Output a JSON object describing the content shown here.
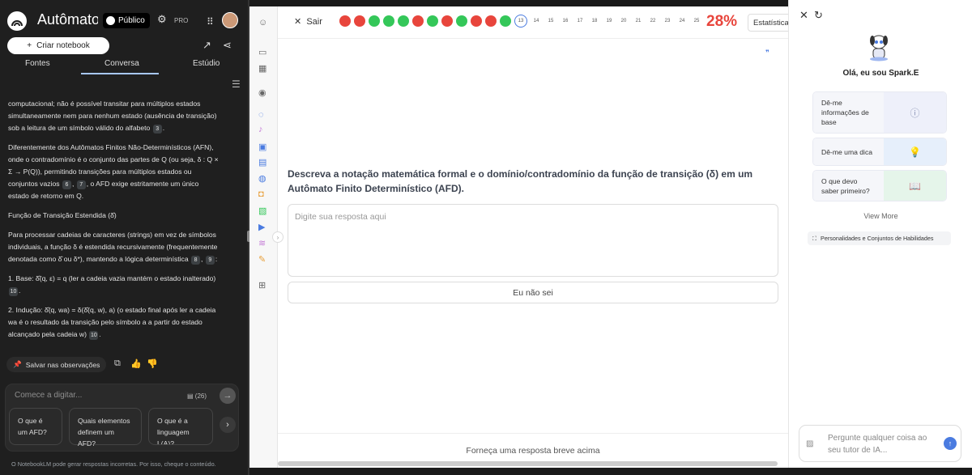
{
  "left": {
    "app_title": "Autômatos F",
    "public_badge": "Público",
    "pro_label": "PRO",
    "create_notebook": "Criar notebook",
    "tabs": [
      "Fontes",
      "Conversa",
      "Estúdio"
    ],
    "paragraphs": [
      "computacional; não é possível transitar para múltiplos estados simultaneamente nem para nenhum estado (ausência de transição) sob a leitura de um símbolo válido do alfabeto",
      "Diferentemente dos Autômatos Finitos Não-Determinísticos (AFN), onde o contradomínio é o conjunto das partes de Q (ou seja, δ : Q × Σ → P(Q)), permitindo transições para múltiplos estados ou conjuntos vazios",
      "Função de Transição Estendida (δ̂)",
      "Para processar cadeias de caracteres (strings) em vez de símbolos individuais, a função δ é estendida recursivamente (frequentemente denotada como δ̂ ou δ*), mantendo a lógica determinística",
      "1. Base: δ̂(q, ε) = q (ler a cadeia vazia mantém o estado inalterado)",
      "2. Indução: δ̂(q, wa) = δ(δ̂(q, w), a) (o estado final após ler a cadeia wa é o resultado da transição pelo símbolo a a partir do estado alcançado pela cadeia w)"
    ],
    "p2_tail": ", o AFD exige estritamente um único estado de retorno em Q.",
    "citations": {
      "c3": "3",
      "c6": "6",
      "c7": "7",
      "c8": "8",
      "c9": "9",
      "c10a": "10",
      "c10b": "10"
    },
    "save_label": "Salvar nas observações",
    "input_placeholder": "Comece a digitar...",
    "source_count": "(26)",
    "suggestions": [
      "O que é um AFD?",
      "Quais elementos definem um AFD?",
      "O que é a linguagem L(A)?"
    ],
    "disclaimer": "O NotebookLM pode gerar respostas incorretas. Por isso, cheque o conteúdo."
  },
  "main": {
    "exit_label": "Sair",
    "progress_items": [
      {
        "label": "",
        "state": "red"
      },
      {
        "label": "",
        "state": "red"
      },
      {
        "label": "",
        "state": "green"
      },
      {
        "label": "",
        "state": "green"
      },
      {
        "label": "",
        "state": "green"
      },
      {
        "label": "",
        "state": "red"
      },
      {
        "label": "",
        "state": "green"
      },
      {
        "label": "",
        "state": "red"
      },
      {
        "label": "",
        "state": "green"
      },
      {
        "label": "",
        "state": "red"
      },
      {
        "label": "",
        "state": "red"
      },
      {
        "label": "",
        "state": "green"
      },
      {
        "label": "13",
        "state": "current"
      },
      {
        "label": "14",
        "state": "empty"
      },
      {
        "label": "15",
        "state": "empty"
      },
      {
        "label": "16",
        "state": "empty"
      },
      {
        "label": "17",
        "state": "empty"
      },
      {
        "label": "18",
        "state": "empty"
      },
      {
        "label": "19",
        "state": "empty"
      },
      {
        "label": "20",
        "state": "empty"
      },
      {
        "label": "21",
        "state": "empty"
      },
      {
        "label": "22",
        "state": "empty"
      },
      {
        "label": "23",
        "state": "empty"
      },
      {
        "label": "24",
        "state": "empty"
      },
      {
        "label": "25",
        "state": "empty"
      }
    ],
    "percent": "28%",
    "stats_label": "Estatística",
    "question": "Descreva a notação matemática formal e o domínio/contradomínio da função de transição (δ) em um Autômato Finito Determinístico (AFD).",
    "answer_placeholder": "Digite sua resposta aqui",
    "idk_label": "Eu não sei",
    "footer": "Forneça uma resposta breve acima"
  },
  "right": {
    "greeting": "Olá, eu sou Spark.E",
    "cards": [
      "Dê-me informações de base",
      "Dê-me uma dica",
      "O que devo saber primeiro?"
    ],
    "view_more": "View More",
    "personalities": "Personalidades e Conjuntos de Habilidades",
    "ask_placeholder": "Pergunte qualquer coisa ao seu tutor de IA..."
  },
  "colors": {
    "accent": "#4a7be0",
    "wrong": "#e8453c",
    "correct": "#34c759"
  }
}
